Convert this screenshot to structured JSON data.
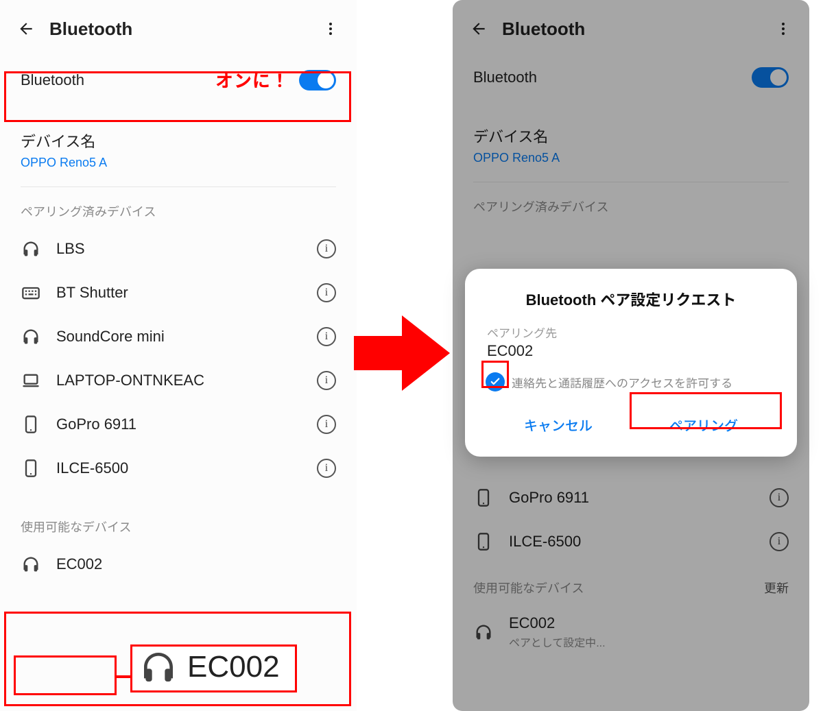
{
  "left": {
    "header": {
      "title": "Bluetooth"
    },
    "bluetooth_label": "Bluetooth",
    "annotation_on": "オンに！",
    "device_name_heading": "デバイス名",
    "device_name_value": "OPPO Reno5 A",
    "paired_heading": "ペアリング済みデバイス",
    "paired": [
      {
        "icon": "headphones",
        "name": "LBS"
      },
      {
        "icon": "keyboard",
        "name": "BT Shutter"
      },
      {
        "icon": "headphones",
        "name": "SoundCore mini"
      },
      {
        "icon": "laptop",
        "name": "LAPTOP-ONTNKEAC"
      },
      {
        "icon": "phone",
        "name": "GoPro 6911"
      },
      {
        "icon": "phone",
        "name": "ILCE-6500"
      }
    ],
    "available_heading": "使用可能なデバイス",
    "available": [
      {
        "icon": "headphones",
        "name": "EC002"
      }
    ],
    "callout_name": "EC002"
  },
  "right": {
    "header": {
      "title": "Bluetooth"
    },
    "bluetooth_label": "Bluetooth",
    "device_name_heading": "デバイス名",
    "device_name_value": "OPPO Reno5 A",
    "paired_heading": "ペアリング済みデバイス",
    "paired_visible": [
      {
        "icon": "phone",
        "name": "GoPro 6911"
      },
      {
        "icon": "phone",
        "name": "ILCE-6500"
      }
    ],
    "available_heading": "使用可能なデバイス",
    "refresh_label": "更新",
    "available": [
      {
        "icon": "headphones",
        "name": "EC002",
        "sub": "ペアとして設定中..."
      }
    ],
    "dialog": {
      "title": "Bluetooth ペア設定リクエスト",
      "pairing_to_label": "ペアリング先",
      "device": "EC002",
      "checkbox_label": "連絡先と通話履歴へのアクセスを許可する",
      "cancel": "キャンセル",
      "pair": "ペアリング"
    }
  }
}
